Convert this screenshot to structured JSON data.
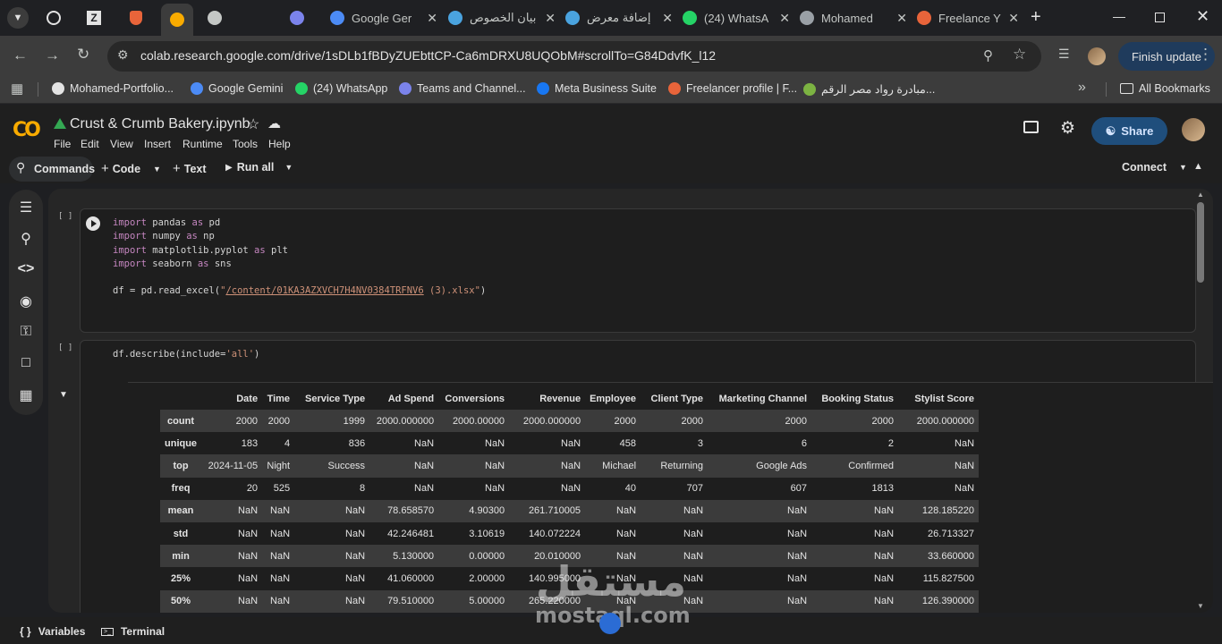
{
  "browser": {
    "tabs": [
      {
        "label": "",
        "fav": "colab-logo-icon",
        "color": "#f9ab00",
        "active": true
      },
      {
        "label": "",
        "fav": "speaker-icon",
        "color": "#c4c7c5"
      },
      {
        "label": "",
        "fav": "teams-icon",
        "color": "#7b83eb"
      },
      {
        "label": "Google Ger",
        "fav": "gemini-icon",
        "color": "#4c8bf5"
      },
      {
        "label": "بيان الخصوص",
        "fav": "blue-circle-icon",
        "color": "#4aa3df"
      },
      {
        "label": "إضافة معرض",
        "fav": "blue-circle-icon",
        "color": "#4aa3df"
      },
      {
        "label": "(24) WhatsA",
        "fav": "whatsapp-icon",
        "color": "#25d366"
      },
      {
        "label": "Mohamed",
        "fav": "globe-icon",
        "color": "#9aa0a6"
      },
      {
        "label": "Freelance Y",
        "fav": "freelancer-icon",
        "color": "#e8643a"
      }
    ],
    "url": "colab.research.google.com/drive/1sDLb1fBDyZUEbttCP-Ca6mDRXU8UQObM#scrollTo=G84DdvfK_l12",
    "finish_update": "Finish update",
    "bookmarks": [
      {
        "label": "Mohamed-Portfolio...",
        "icon": "github-icon"
      },
      {
        "label": "Google Gemini",
        "icon": "gemini-icon"
      },
      {
        "label": "(24) WhatsApp",
        "icon": "whatsapp-icon"
      },
      {
        "label": "Teams and Channel...",
        "icon": "teams-icon"
      },
      {
        "label": "Meta Business Suite",
        "icon": "meta-icon"
      },
      {
        "label": "Freelancer profile | F...",
        "icon": "freelancer-icon"
      },
      {
        "label": "مبادرة رواد مصر الرقم...",
        "icon": "chart-icon"
      }
    ],
    "all_bookmarks": "All Bookmarks"
  },
  "colab": {
    "logo": "CO",
    "title": "Crust & Crumb Bakery.ipynb",
    "menus": [
      "File",
      "Edit",
      "View",
      "Insert",
      "Runtime",
      "Tools",
      "Help"
    ],
    "share": "Share",
    "toolbar": {
      "commands": "Commands",
      "code": "Code",
      "text": "Text",
      "run_all": "Run all",
      "connect": "Connect"
    }
  },
  "cells": {
    "exec_label": "[ ]",
    "df_describe": "df.describe(include='all')"
  },
  "describe_table": {
    "columns": [
      "",
      "Date",
      "Time",
      "Service Type",
      "Ad Spend",
      "Conversions",
      "Revenue",
      "Employee",
      "Client Type",
      "Marketing Channel",
      "Booking Status",
      "Stylist Score"
    ],
    "rows": [
      [
        "count",
        "2000",
        "2000",
        "1999",
        "2000.000000",
        "2000.00000",
        "2000.000000",
        "2000",
        "2000",
        "2000",
        "2000",
        "2000.000000"
      ],
      [
        "unique",
        "183",
        "4",
        "836",
        "NaN",
        "NaN",
        "NaN",
        "458",
        "3",
        "6",
        "2",
        "NaN"
      ],
      [
        "top",
        "2024-11-05",
        "Night",
        "Success",
        "NaN",
        "NaN",
        "NaN",
        "Michael",
        "Returning",
        "Google Ads",
        "Confirmed",
        "NaN"
      ],
      [
        "freq",
        "20",
        "525",
        "8",
        "NaN",
        "NaN",
        "NaN",
        "40",
        "707",
        "607",
        "1813",
        "NaN"
      ],
      [
        "mean",
        "NaN",
        "NaN",
        "NaN",
        "78.658570",
        "4.90300",
        "261.710005",
        "NaN",
        "NaN",
        "NaN",
        "NaN",
        "128.185220"
      ],
      [
        "std",
        "NaN",
        "NaN",
        "NaN",
        "42.246481",
        "3.10619",
        "140.072224",
        "NaN",
        "NaN",
        "NaN",
        "NaN",
        "26.713327"
      ],
      [
        "min",
        "NaN",
        "NaN",
        "NaN",
        "5.130000",
        "0.00000",
        "20.010000",
        "NaN",
        "NaN",
        "NaN",
        "NaN",
        "33.660000"
      ],
      [
        "25%",
        "NaN",
        "NaN",
        "NaN",
        "41.060000",
        "2.00000",
        "140.995000",
        "NaN",
        "NaN",
        "NaN",
        "NaN",
        "115.827500"
      ],
      [
        "50%",
        "NaN",
        "NaN",
        "NaN",
        "79.510000",
        "5.00000",
        "265.220000",
        "NaN",
        "NaN",
        "NaN",
        "NaN",
        "126.390000"
      ]
    ]
  },
  "statusbar": {
    "variables": "Variables",
    "terminal": "Terminal"
  },
  "watermark": {
    "arabic": "مستقل",
    "latin": "mostaql.com"
  }
}
